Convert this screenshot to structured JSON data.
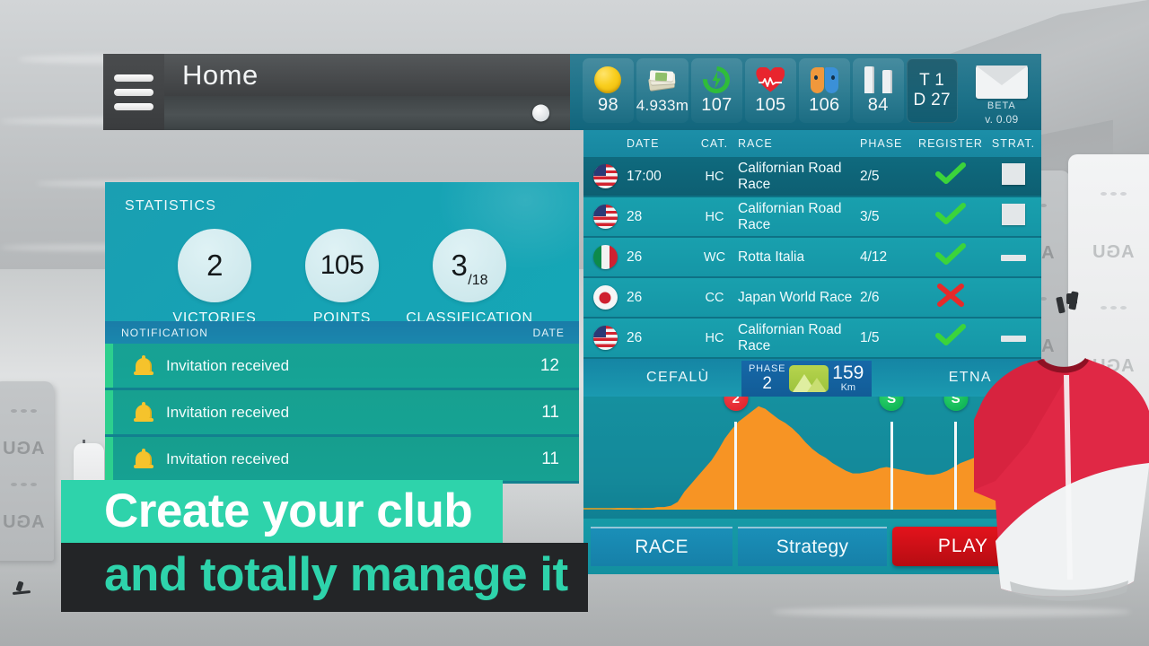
{
  "background": {
    "scene": "ski-slope-grayscale",
    "banner_logo": "AGU"
  },
  "topbar": {
    "menu_icon": "hamburger-menu-icon",
    "title": "Home",
    "slider_value": 90
  },
  "resources": [
    {
      "id": "coins",
      "icon": "coin-icon",
      "value": "98"
    },
    {
      "id": "money",
      "icon": "money-icon",
      "value": "4.933m"
    },
    {
      "id": "energy",
      "icon": "energy-icon",
      "value": "107"
    },
    {
      "id": "health",
      "icon": "heart-icon",
      "value": "105"
    },
    {
      "id": "morale",
      "icon": "masks-icon",
      "value": "106"
    },
    {
      "id": "buildings",
      "icon": "towers-icon",
      "value": "84"
    }
  ],
  "calendar": {
    "turn": "T 1",
    "day": "D 27"
  },
  "mail": {
    "icon": "envelope-icon",
    "beta": "BETA",
    "version": "v. 0.09"
  },
  "statistics": {
    "label": "STATISTICS",
    "items": [
      {
        "value": "2",
        "fraction": "",
        "caption": "VICTORIES"
      },
      {
        "value": "105",
        "fraction": "",
        "caption": "POINTS"
      },
      {
        "value": "3",
        "fraction": "/18",
        "caption": "CLASSIFICATION"
      }
    ]
  },
  "notifications": {
    "header": {
      "title": "NOTIFICATION",
      "date": "DATE"
    },
    "rows": [
      {
        "icon": "bell-icon",
        "text": "Invitation received",
        "date": "12"
      },
      {
        "icon": "bell-icon",
        "text": "Invitation received",
        "date": "11"
      },
      {
        "icon": "bell-icon",
        "text": "Invitation received",
        "date": "11"
      }
    ]
  },
  "races": {
    "columns": [
      "DATE",
      "CAT.",
      "RACE",
      "PHASE",
      "REGISTER",
      "STRAT."
    ],
    "rows": [
      {
        "flag": "us",
        "date": "17:00",
        "cat": "HC",
        "race": "Californian Road Race",
        "phase": "2/5",
        "register": "check",
        "strat": "box"
      },
      {
        "flag": "us",
        "date": "28",
        "cat": "HC",
        "race": "Californian Road Race",
        "phase": "3/5",
        "register": "check",
        "strat": "box"
      },
      {
        "flag": "it",
        "date": "26",
        "cat": "WC",
        "race": "Rotta Italia",
        "phase": "4/12",
        "register": "check",
        "strat": "dash"
      },
      {
        "flag": "jp",
        "date": "26",
        "cat": "CC",
        "race": "Japan World Race",
        "phase": "2/6",
        "register": "cross",
        "strat": "none"
      },
      {
        "flag": "us",
        "date": "26",
        "cat": "HC",
        "race": "Californian Road Race",
        "phase": "1/5",
        "register": "check",
        "strat": "dash"
      }
    ]
  },
  "stage": {
    "start_city": "CEFALÙ",
    "end_city": "ETNA",
    "phase_label": "PHASE",
    "phase_value": "2",
    "distance_value": "159",
    "distance_unit": "Km",
    "terrain_icon": "mountain-icon",
    "markers": [
      {
        "label": "2",
        "type": "red",
        "position_pct": 33
      },
      {
        "label": "S",
        "type": "green",
        "position_pct": 67
      },
      {
        "label": "S",
        "type": "green",
        "position_pct": 81
      }
    ],
    "profile_points": [
      0,
      0,
      0,
      0,
      0,
      1,
      1,
      1,
      0,
      1,
      1,
      2,
      2,
      3,
      6,
      14,
      20,
      26,
      32,
      38,
      46,
      55,
      62,
      68,
      72,
      76,
      80,
      78,
      74,
      70,
      67,
      63,
      58,
      52,
      47,
      43,
      40,
      36,
      33,
      30,
      28,
      28,
      29,
      30,
      32,
      33,
      32,
      31,
      30,
      29,
      28,
      27,
      27,
      28,
      30,
      33,
      36,
      38,
      40,
      42,
      44,
      46,
      48,
      50,
      54,
      58,
      64,
      70,
      74
    ]
  },
  "footer": {
    "race_label": "RACE",
    "strategy_label": "Strategy",
    "play_label": "PLAY"
  },
  "promo": {
    "line1": "Create your club",
    "line2": "and totally manage it",
    "line1_bg": "#2ed3ab",
    "line1_fg": "#ffffff",
    "line2_bg": "#232527",
    "line2_fg": "#2ed3ab"
  }
}
